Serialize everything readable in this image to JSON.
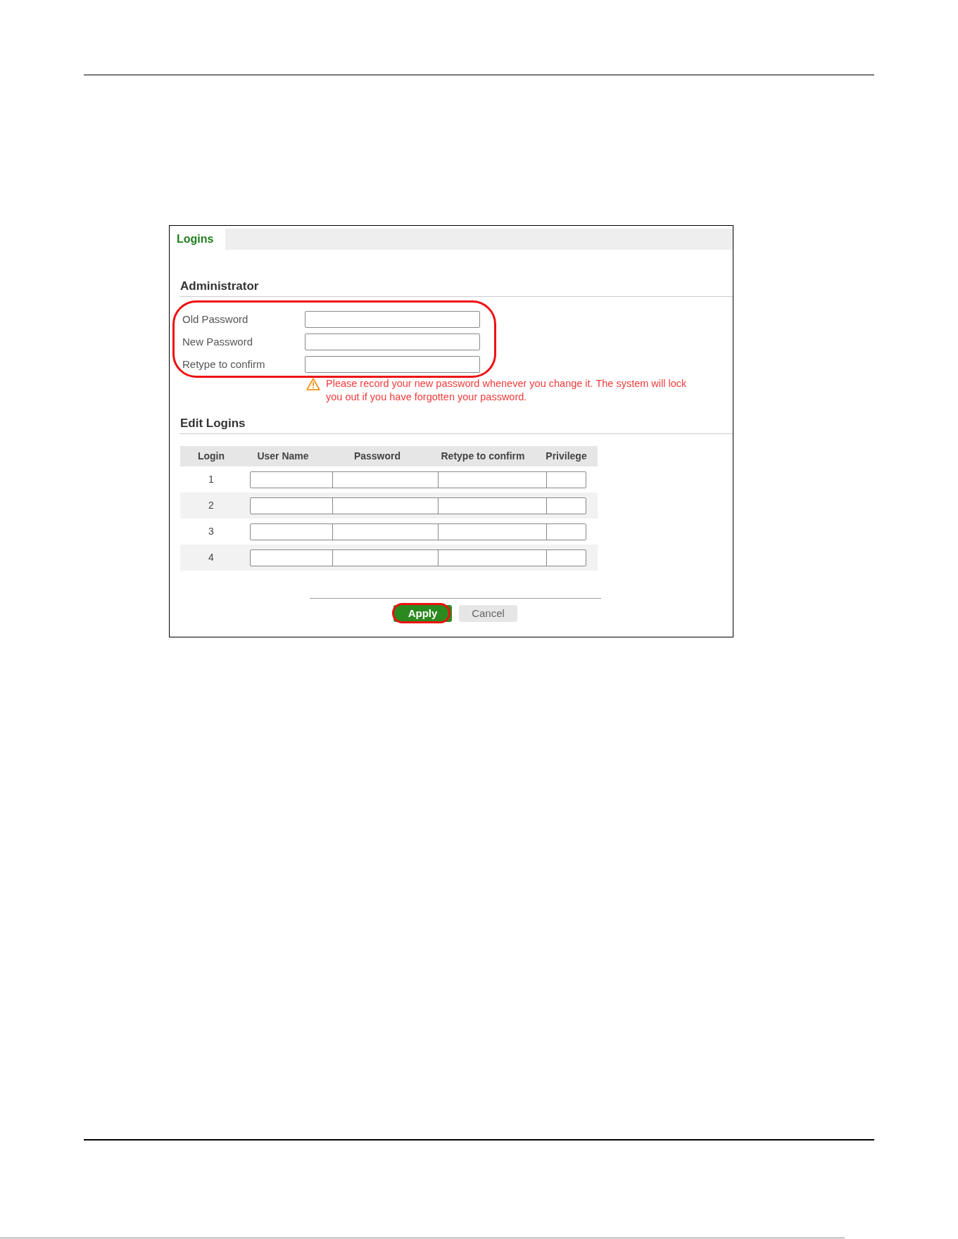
{
  "tabs": [
    {
      "label": "Logins",
      "selected": true
    }
  ],
  "administrator": {
    "title": "Administrator",
    "highlighted": true,
    "fields": [
      {
        "label": "Old Password"
      },
      {
        "label": "New Password"
      },
      {
        "label": "Retype to confirm"
      }
    ],
    "warning": "Please record your new password whenever you change it. The system will lock you out if you have forgotten your password."
  },
  "edit_logins": {
    "title": "Edit Logins",
    "columns": [
      "Login",
      "User Name",
      "Password",
      "Retype to confirm",
      "Privilege"
    ],
    "rows": [
      {
        "login": "1"
      },
      {
        "login": "2"
      },
      {
        "login": "3"
      },
      {
        "login": "4"
      }
    ]
  },
  "buttons": [
    {
      "label": "Apply",
      "kind": "primary",
      "highlighted": true
    },
    {
      "label": "Cancel",
      "kind": "secondary",
      "highlighted": false
    }
  ]
}
